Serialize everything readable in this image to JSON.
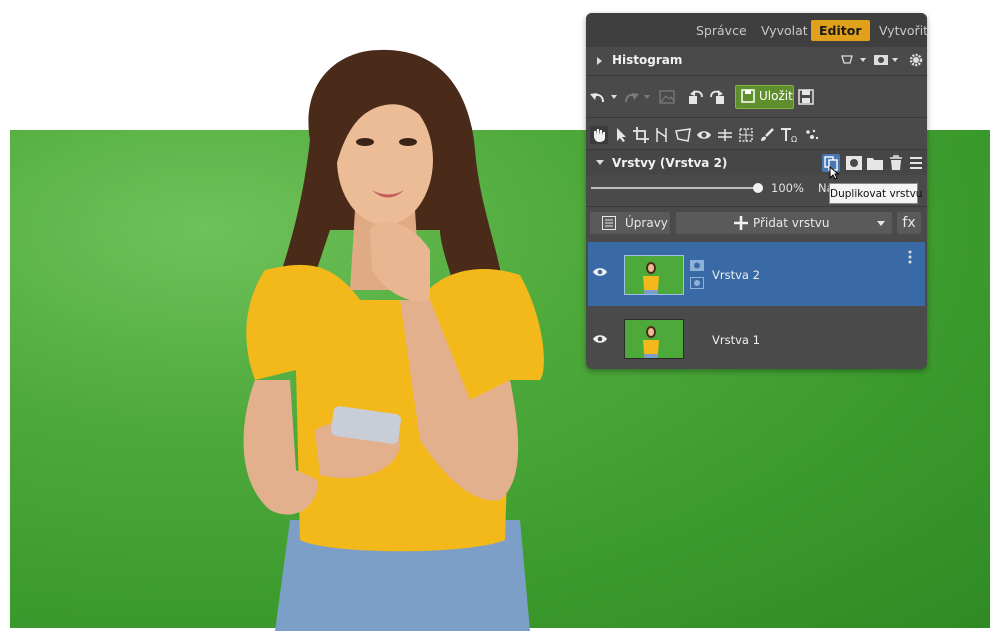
{
  "photo": {
    "subject": "woman-in-yellow-shirt-holding-phone",
    "background_color": "#4ea93b"
  },
  "modes": {
    "items": [
      {
        "label": "Správce",
        "active": false
      },
      {
        "label": "Vyvolat",
        "active": false
      },
      {
        "label": "Editor",
        "active": true
      },
      {
        "label": "Vytvořit",
        "active": false
      }
    ],
    "active_color": "#e0a019"
  },
  "histogram": {
    "title": "Histogram"
  },
  "toolbar": {
    "save_label": "Uložit",
    "save_color": "#5f8f2d"
  },
  "layers": {
    "title": "Vrstvy (Vrstva 2)",
    "opacity": "100%",
    "blend_peek": "Na",
    "tooltip": "Duplikovat vrstvu",
    "adjust_label": "Úpravy",
    "add_layer_label": "Přidat vrstvu",
    "fx_label": "fx",
    "selected_color": "#3a6aa5",
    "items": [
      {
        "name": "Vrstva 2",
        "selected": true
      },
      {
        "name": "Vrstva 1",
        "selected": false
      }
    ]
  }
}
